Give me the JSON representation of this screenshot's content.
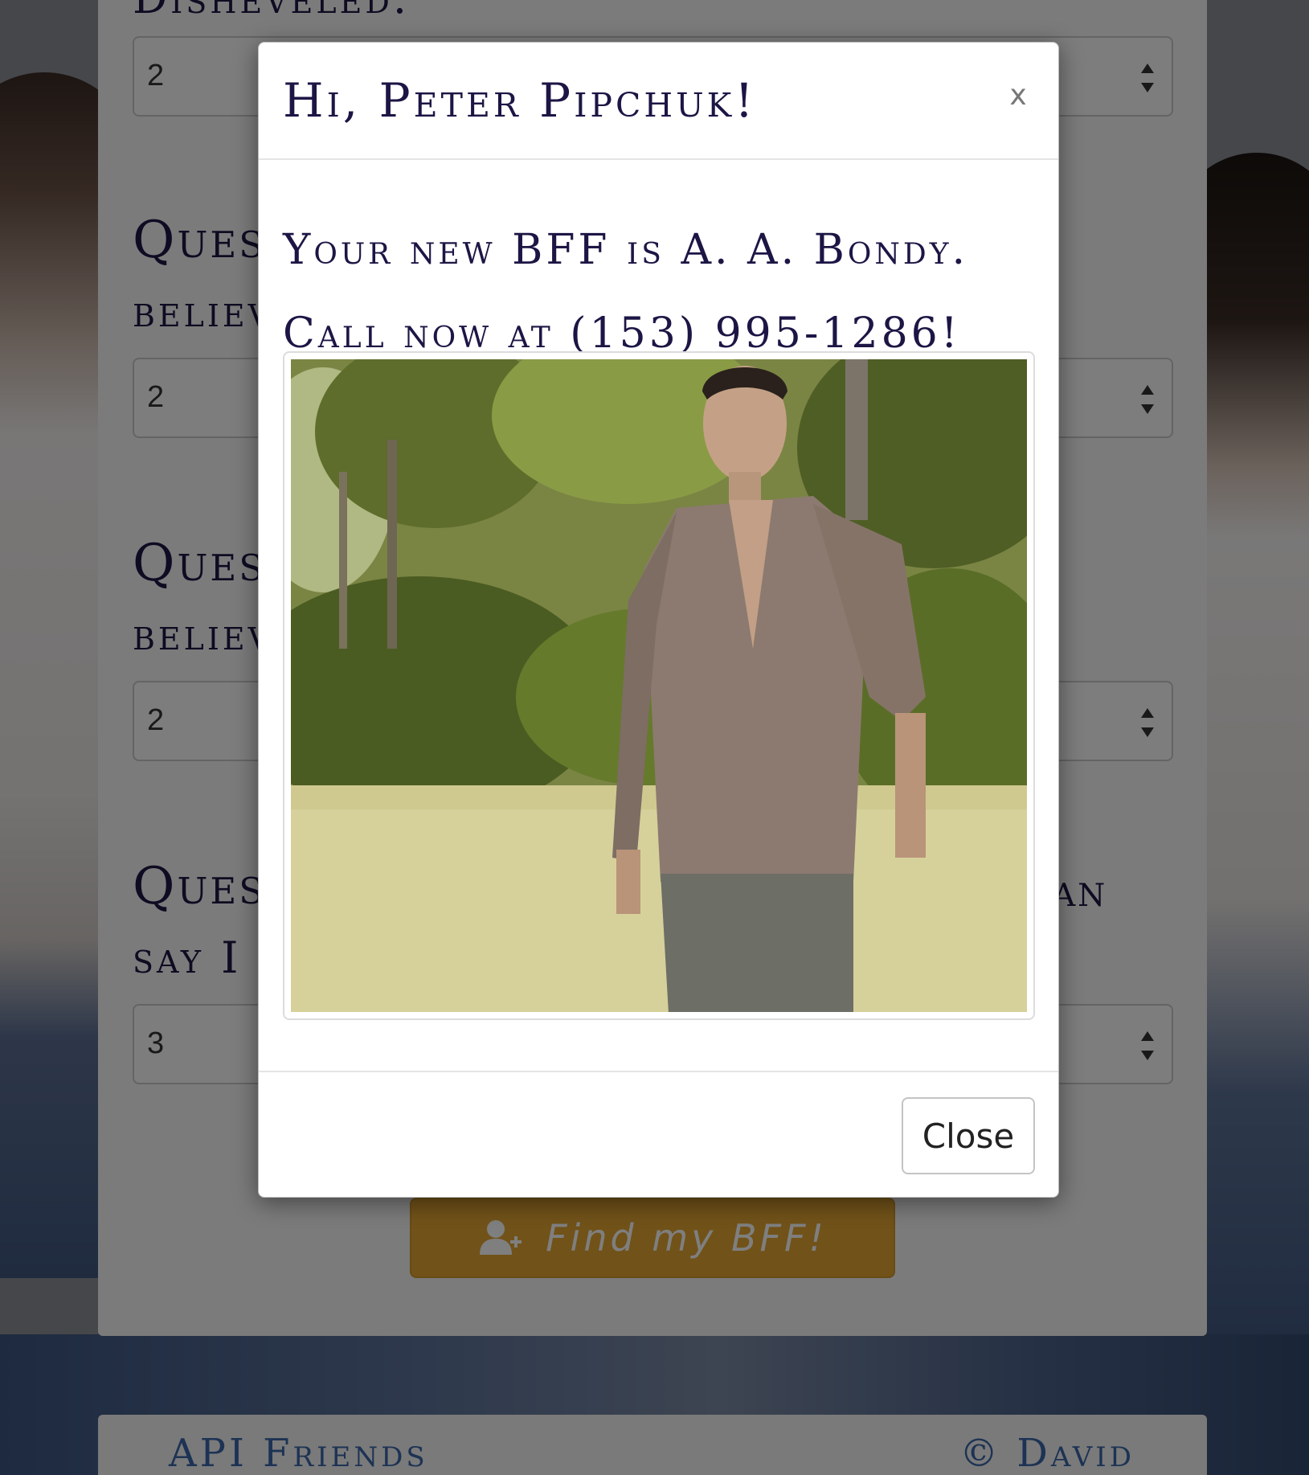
{
  "background": {
    "question_top_partial": "Disheveled.",
    "question_labels": [
      "Ques",
      "Ques",
      "Ques"
    ],
    "question_subs": [
      "believ",
      "believ",
      "say I"
    ],
    "question_tail": "an",
    "select_values": [
      "2",
      "2",
      "2",
      "3"
    ],
    "find_button_label": "Find my BFF!",
    "footer_left": "API Friends",
    "footer_right": "© David"
  },
  "modal": {
    "title": "Hi, Peter Pipchuk!",
    "close_x": "x",
    "line1": "Your new BFF is A. A. Bondy.",
    "line2": "Call now at (153) 995-1286!",
    "close_button": "Close"
  },
  "colors": {
    "text_primary": "#1c1645",
    "accent_button": "#e2a532",
    "footer_link": "#3b66a8"
  },
  "icons": {
    "select_arrows": "updown-arrows-icon",
    "find_button": "add-user-icon"
  }
}
